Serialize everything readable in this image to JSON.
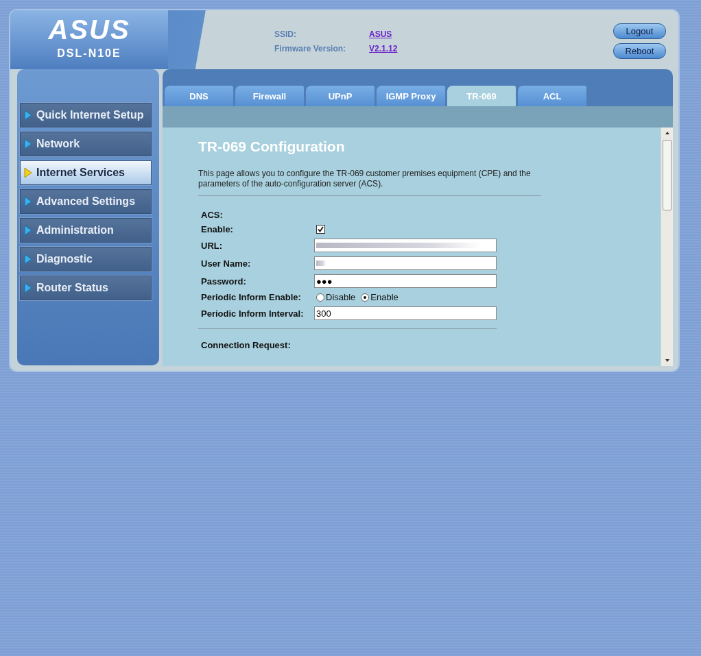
{
  "header": {
    "logo": "ASUS",
    "model": "DSL-N10E",
    "info": [
      {
        "label": "SSID:",
        "value": "ASUS"
      },
      {
        "label": "Firmware Version:",
        "value": "V2.1.12"
      }
    ],
    "buttons": [
      "Logout",
      "Reboot"
    ]
  },
  "sidebar": {
    "items": [
      {
        "label": "Quick Internet Setup",
        "selected": false
      },
      {
        "label": "Network",
        "selected": false
      },
      {
        "label": "Internet Services",
        "selected": true
      },
      {
        "label": "Advanced Settings",
        "selected": false
      },
      {
        "label": "Administration",
        "selected": false
      },
      {
        "label": "Diagnostic",
        "selected": false
      },
      {
        "label": "Router Status",
        "selected": false
      }
    ]
  },
  "tabs": [
    {
      "label": "DNS",
      "selected": false
    },
    {
      "label": "Firewall",
      "selected": false
    },
    {
      "label": "UPnP",
      "selected": false
    },
    {
      "label": "IGMP Proxy",
      "selected": false
    },
    {
      "label": "TR-069",
      "selected": true
    },
    {
      "label": "ACL",
      "selected": false
    }
  ],
  "content": {
    "title": "TR-069 Configuration",
    "description": "This page allows you to configure the TR-069 customer premises equipment (CPE) and the parameters of the auto-configuration server (ACS).",
    "section": "ACS:",
    "fields": [
      {
        "kind": "checkbox",
        "label": "Enable:",
        "checked": true
      },
      {
        "kind": "redacted",
        "label": "URL:"
      },
      {
        "kind": "redacted",
        "label": "User Name:"
      },
      {
        "kind": "text",
        "label": "Password:",
        "value": "●●●"
      },
      {
        "kind": "radio",
        "label": "Periodic Inform Enable:",
        "options": [
          {
            "label": "Disable",
            "selected": false
          },
          {
            "label": "Enable",
            "selected": true
          }
        ]
      },
      {
        "kind": "text",
        "label": "Periodic Inform Interval:",
        "value": "300"
      }
    ],
    "next_section": "Connection Request:"
  }
}
